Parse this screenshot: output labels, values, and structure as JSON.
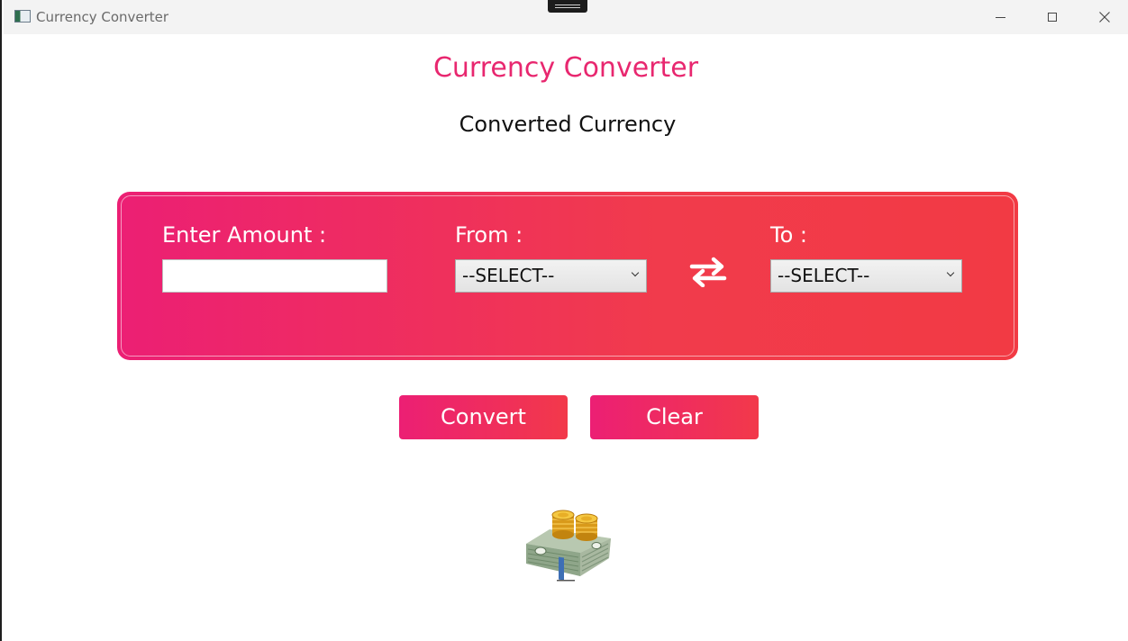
{
  "window": {
    "title": "Currency Converter"
  },
  "app": {
    "heading": "Currency Converter",
    "result_text": "Converted Currency"
  },
  "form": {
    "amount_label": "Enter Amount :",
    "amount_value": "",
    "from_label": "From :",
    "from_selected": "--SELECT--",
    "to_label": "To :",
    "to_selected": "--SELECT--",
    "swap_icon": "swap-arrows-icon"
  },
  "actions": {
    "convert_label": "Convert",
    "clear_label": "Clear"
  },
  "colors": {
    "accent": "#e8276f",
    "gradient_start": "#ec1f74",
    "gradient_end": "#f23a44"
  },
  "icons": {
    "app": "app-window-icon",
    "minimize": "minimize-icon",
    "maximize": "maximize-icon",
    "close": "close-icon",
    "illustration": "money-stack-coins-icon"
  }
}
